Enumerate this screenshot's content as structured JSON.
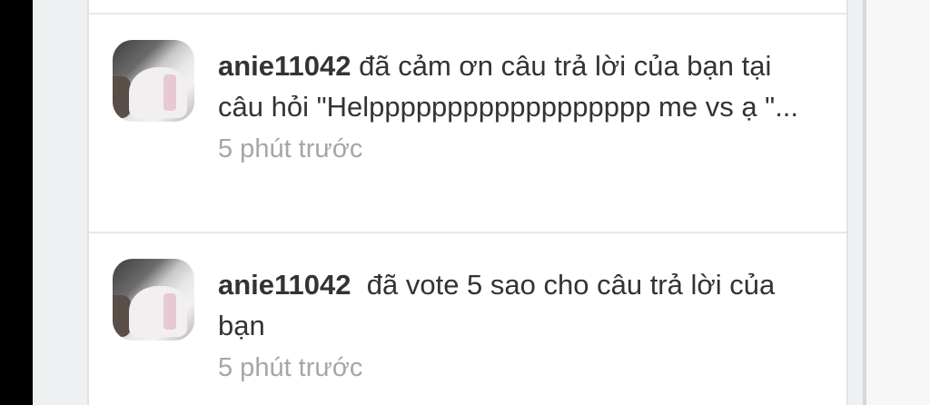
{
  "notifications": [
    {
      "username": "anie11042",
      "text": " đã cảm ơn câu trả lời của bạn tại câu hỏi \"Helpppppppppppppppppp me vs ạ \"...",
      "time": "5 phút trước"
    },
    {
      "username": "anie11042",
      "text": "  đã vote 5 sao cho câu trả lời của bạn",
      "time": "5 phút trước"
    }
  ]
}
